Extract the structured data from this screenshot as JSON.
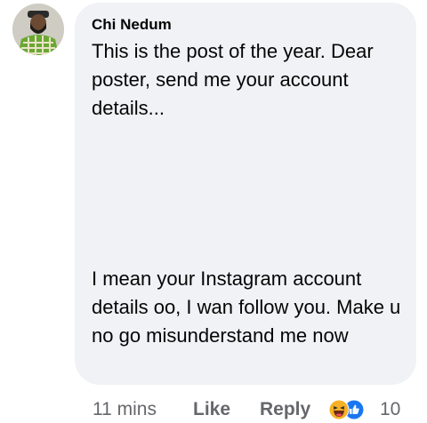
{
  "comment": {
    "author": "Chi Nedum",
    "paragraph_1": "This is the post of the year. Dear poster, send me your account details...",
    "paragraph_2": "I mean your Instagram account details oo, I wan follow you. Make u no go misunderstand me now"
  },
  "actions": {
    "time": "11 mins",
    "like_label": "Like",
    "reply_label": "Reply",
    "reaction_icons": [
      "haha-emoji-icon",
      "like-thumb-icon"
    ],
    "reaction_count": "10"
  },
  "colors": {
    "bubble_bg": "#f0f2f5",
    "text": "#050505",
    "meta_text": "#65676b",
    "like_blue": "#1877f2",
    "haha_yellow": "#f7b125"
  }
}
